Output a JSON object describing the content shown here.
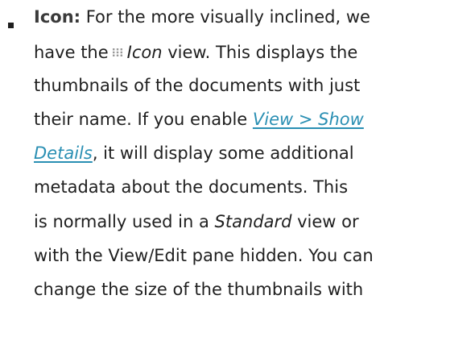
{
  "item": {
    "term": "Icon:",
    "line1_rest": " For the more visually inclined, we",
    "line2_pre": "have the",
    "icon_name": "grid-icon",
    "line2_em": "Icon",
    "line2_post": " view. This displays the",
    "line3": "thumbnails of the documents with just",
    "line4_pre": "their name. If you enable ",
    "link_part1": "View > Show",
    "link_part2": "Details",
    "line5_post": ", it will display some additional",
    "line6": "metadata about the documents. This",
    "line7_pre": "is normally used in a ",
    "line7_em": "Standard",
    "line7_post": " view or",
    "line8": "with the View/Edit pane hidden. You can",
    "line9": "change the size of the thumbnails with"
  },
  "colors": {
    "text": "#1f1f1f",
    "link": "#2a8fb3"
  }
}
